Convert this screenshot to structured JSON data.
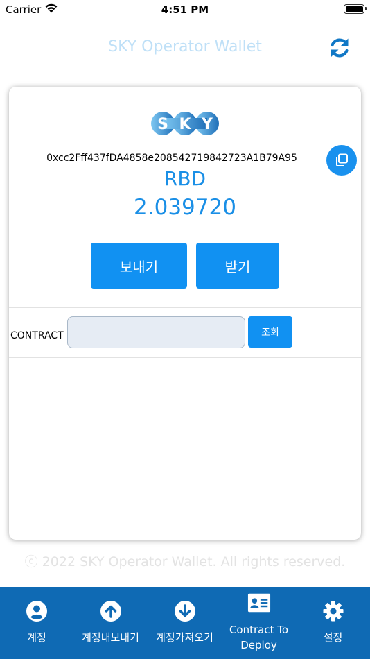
{
  "status_bar": {
    "carrier": "Carrier",
    "time": "4:51 PM"
  },
  "header": {
    "title": "SKY Operator Wallet",
    "refresh_icon": "refresh-icon"
  },
  "wallet": {
    "logo_text": "SKY",
    "address": "0xcc2Fff437fDA4858e208542719842723A1B79A95",
    "copy_icon": "copy-icon",
    "symbol": "RBD",
    "balance": "2.039720",
    "send_label": "보내기",
    "receive_label": "받기"
  },
  "contract": {
    "label": "CONTRACT :",
    "input_value": "",
    "query_label": "조회"
  },
  "footer": {
    "copyright": "ⓒ 2022 SKY Operator Wallet. All rights reserved."
  },
  "tabs": [
    {
      "label": "계정",
      "icon": "user-circle-icon"
    },
    {
      "label": "계정내보내기",
      "icon": "arrow-up-circle-icon"
    },
    {
      "label": "계정가져오기",
      "icon": "arrow-down-circle-icon"
    },
    {
      "label": "Contract To Deploy",
      "icon": "id-card-icon"
    },
    {
      "label": "설정",
      "icon": "gear-icon"
    }
  ],
  "colors": {
    "primary": "#1191f2",
    "tabbar": "#0f6ab4",
    "title": "#bfe0f7",
    "balance_text": "#1a8fe6"
  }
}
